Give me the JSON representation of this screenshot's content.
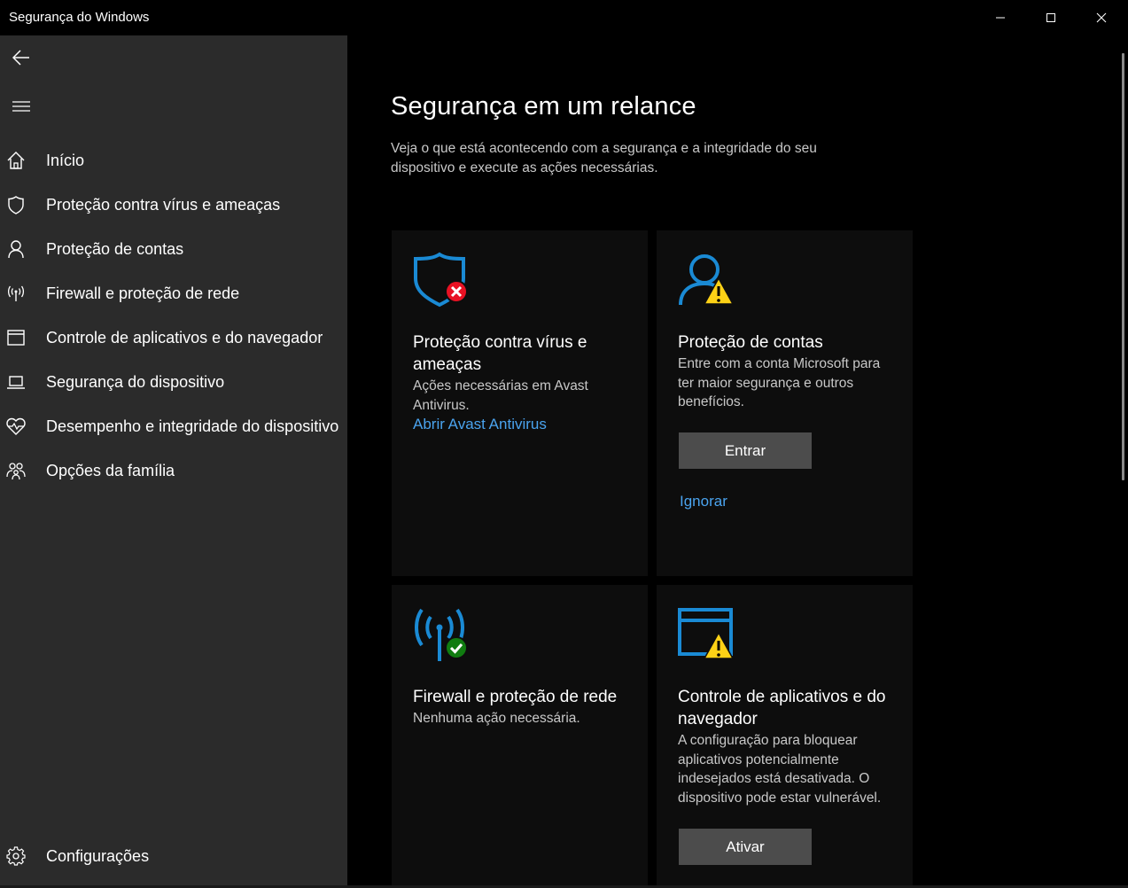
{
  "window": {
    "title": "Segurança do Windows"
  },
  "sidebar": {
    "items": [
      {
        "label": "Início",
        "icon": "home-icon"
      },
      {
        "label": "Proteção contra vírus e ameaças",
        "icon": "shield-icon"
      },
      {
        "label": "Proteção de contas",
        "icon": "person-icon"
      },
      {
        "label": "Firewall e proteção de rede",
        "icon": "antenna-icon"
      },
      {
        "label": "Controle de aplicativos e do navegador",
        "icon": "browser-window-icon"
      },
      {
        "label": "Segurança do dispositivo",
        "icon": "laptop-icon"
      },
      {
        "label": "Desempenho e integridade do dispositivo",
        "icon": "heart-pulse-icon"
      },
      {
        "label": "Opções da família",
        "icon": "family-icon"
      }
    ],
    "settings_label": "Configurações"
  },
  "main": {
    "title": "Segurança em um relance",
    "description": "Veja o que está acontecendo com a segurança e a integridade do seu dispositivo e execute as ações necessárias.",
    "cards": [
      {
        "title": "Proteção contra vírus e ameaças",
        "text": "Ações necessárias em Avast Antivirus.",
        "link": "Abrir Avast Antivirus",
        "status": "error"
      },
      {
        "title": "Proteção de contas",
        "text": "Entre com a conta Microsoft para ter maior segurança e outros benefícios.",
        "button": "Entrar",
        "link": "Ignorar",
        "status": "warning"
      },
      {
        "title": "Firewall e proteção de rede",
        "text": "Nenhuma ação necessária.",
        "status": "ok"
      },
      {
        "title": "Controle de aplicativos e do navegador",
        "text": "A configuração para bloquear aplicativos potencialmente indesejados está desativada. O dispositivo pode estar vulnerável.",
        "button": "Ativar",
        "status": "warning"
      }
    ]
  },
  "colors": {
    "accent": "#1a8ad4",
    "link": "#4aa3ee",
    "error": "#e81123",
    "warning": "#fcd116",
    "ok": "#107c10",
    "sidebar_bg": "#2b2b2b",
    "card_bg": "#0d0d0d",
    "button_bg": "#4c4c4c"
  }
}
